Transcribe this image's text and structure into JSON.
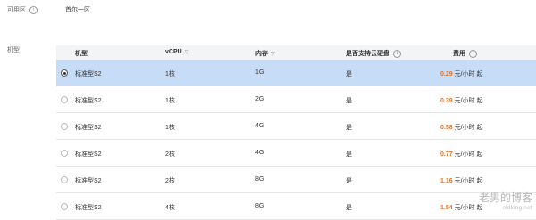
{
  "zone": {
    "label": "可用区",
    "value": "首尔一区"
  },
  "instance_type": {
    "label": "机型"
  },
  "table": {
    "columns": {
      "type": "机型",
      "vcpu": "vCPU",
      "memory": "内存",
      "cloud_disk": "是否支持云硬盘",
      "cost": "费用"
    },
    "rows": [
      {
        "type": "标准型S2",
        "vcpu": "1核",
        "memory": "1G",
        "cloud_disk": "是",
        "price": "0.29",
        "unit": " 元/小时 起",
        "selected": true
      },
      {
        "type": "标准型S2",
        "vcpu": "1核",
        "memory": "2G",
        "cloud_disk": "是",
        "price": "0.39",
        "unit": " 元/小时 起",
        "selected": false
      },
      {
        "type": "标准型S2",
        "vcpu": "1核",
        "memory": "4G",
        "cloud_disk": "是",
        "price": "0.58",
        "unit": " 元/小时 起",
        "selected": false
      },
      {
        "type": "标准型S2",
        "vcpu": "2核",
        "memory": "4G",
        "cloud_disk": "是",
        "price": "0.77",
        "unit": " 元/小时 起",
        "selected": false
      },
      {
        "type": "标准型S2",
        "vcpu": "2核",
        "memory": "8G",
        "cloud_disk": "是",
        "price": "1.16",
        "unit": " 元/小时 起",
        "selected": false
      },
      {
        "type": "标准型S2",
        "vcpu": "4核",
        "memory": "8G",
        "cloud_disk": "是",
        "price": "1.54",
        "unit": " 元/小时 起",
        "selected": false
      }
    ]
  },
  "icons": {
    "info": "info-icon",
    "filter": "filter-icon"
  },
  "colors": {
    "selected_row": "#c6dcf7",
    "price": "#f56c1a",
    "header_bg": "#f3f4f6"
  },
  "watermark": {
    "title": "老男的博客",
    "subtitle": "oldking.net"
  }
}
